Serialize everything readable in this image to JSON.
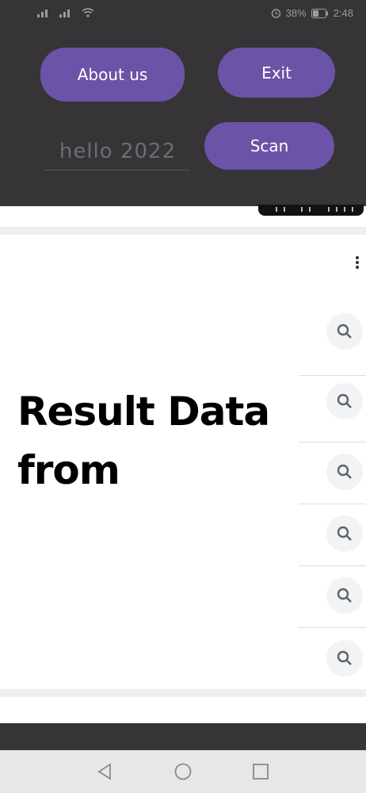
{
  "status_bar": {
    "battery": "38%",
    "time": "2:48"
  },
  "header": {
    "about_label": "About us",
    "exit_label": "Exit",
    "scan_label": "Scan",
    "input_value": "hello   2022"
  },
  "main": {
    "result_text": "Result Data from",
    "search_rows": 6
  },
  "colors": {
    "appbar_bg": "#363437",
    "button_bg": "#6b54a7",
    "button_text": "#ffffff"
  },
  "icons": [
    "signal-icon",
    "wifi-icon",
    "alarm-icon",
    "battery-icon",
    "kebab-menu-icon",
    "search-icon",
    "back-icon",
    "home-icon",
    "recents-icon"
  ]
}
